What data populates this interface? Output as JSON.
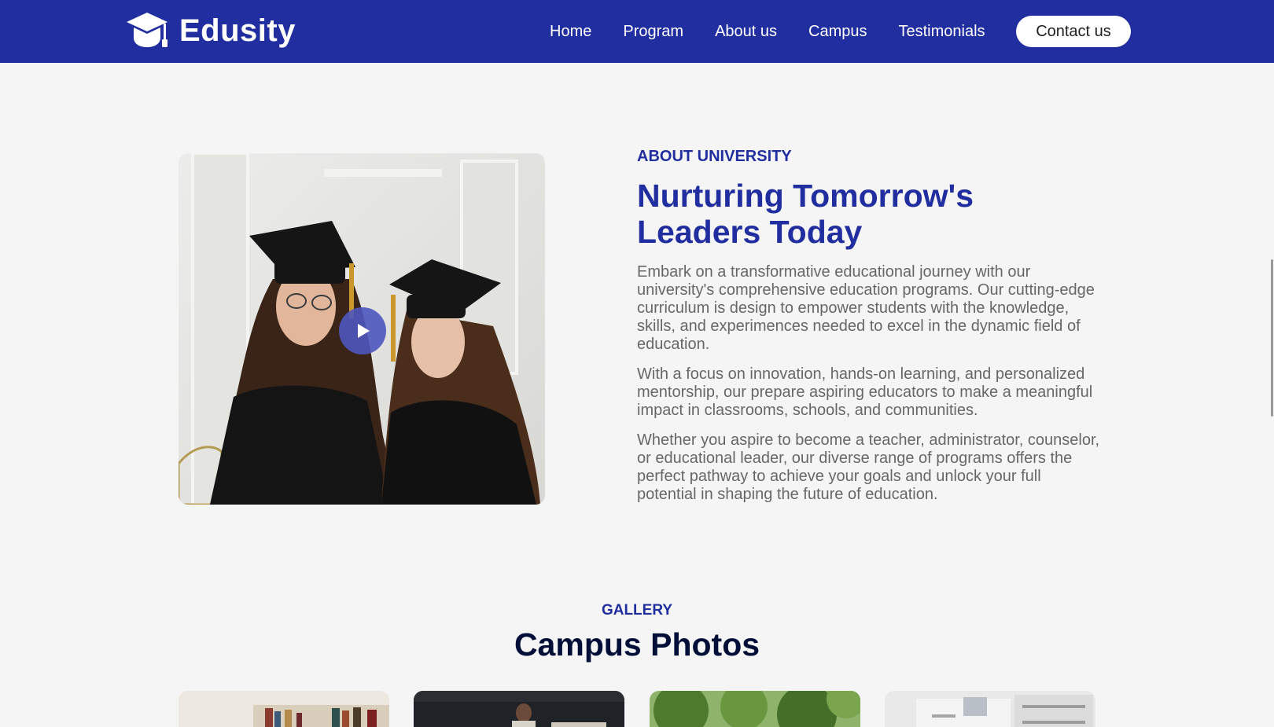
{
  "brand": {
    "name": "Edusity",
    "logo_icon": "graduation-cap-icon"
  },
  "nav": {
    "links": [
      "Home",
      "Program",
      "About us",
      "Campus",
      "Testimonials"
    ],
    "cta": "Contact us"
  },
  "about": {
    "eyebrow": "ABOUT UNIVERSITY",
    "heading": "Nurturing Tomorrow's Leaders Today",
    "paragraphs": [
      "Embark on a transformative educational journey with our university's comprehensive education programs. Our cutting-edge curriculum is design to empower students with the knowledge, skills, and experimences needed to excel in the dynamic field of education.",
      "With a focus on innovation, hands-on learning, and personalized mentorship, our prepare aspiring educators to make a meaningful impact in classrooms, schools, and communities.",
      "Whether you aspire to become a teacher, administrator, counselor, or educational leader, our diverse range of programs offers the perfect pathway to achieve your goals and unlock your full potential in shaping the future of education."
    ],
    "image_icon": "graduates-photo",
    "play_icon": "play-icon"
  },
  "gallery": {
    "eyebrow": "GALLERY",
    "heading": "Campus Photos"
  },
  "colors": {
    "primary": "#212ea0",
    "heading_dark": "#000f38",
    "body_text": "#676767",
    "background": "#f5f5f5"
  }
}
